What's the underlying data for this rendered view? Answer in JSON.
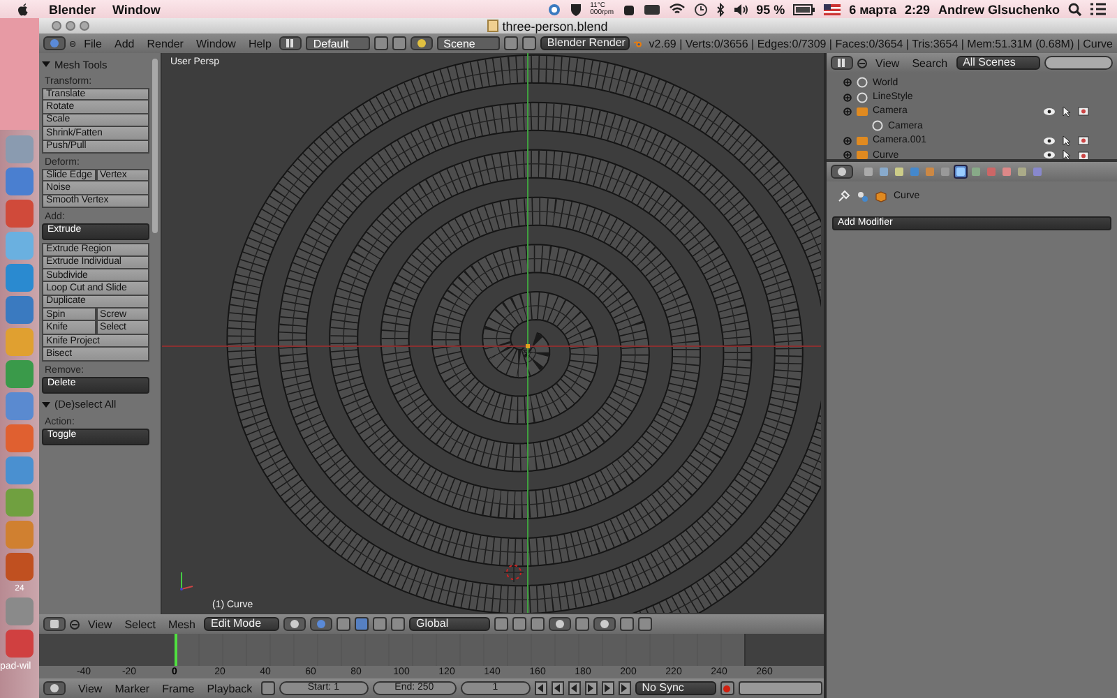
{
  "menubar": {
    "app": "Blender",
    "items": [
      "Window"
    ],
    "sensor": [
      "11°C",
      "000rpm"
    ],
    "battery": "95 %",
    "date": "6 марта",
    "time": "2:29",
    "user": "Andrew Glsuchenko"
  },
  "dock": {
    "badge": "24",
    "label": "pad-wil"
  },
  "window": {
    "title": "three-person.blend"
  },
  "info_header": {
    "menus": [
      "File",
      "Add",
      "Render",
      "Window",
      "Help"
    ],
    "layout": "Default",
    "scene": "Scene",
    "engine": "Blender Render",
    "stats": "v2.69 | Verts:0/3656 | Edges:0/7309 | Faces:0/3654 | Tris:3654 | Mem:51.31M (0.68M) | Curve"
  },
  "tool_panels": [
    {
      "title": "Mesh Tools",
      "expanded": true,
      "groups": [
        {
          "label": "Transform:",
          "rows": [
            [
              "Translate"
            ],
            [
              "Rotate"
            ],
            [
              "Scale"
            ],
            [
              "Shrink/Fatten"
            ],
            [
              "Push/Pull"
            ]
          ]
        },
        {
          "label": "Deform:",
          "rows": [
            [
              "Slide Edge",
              "Vertex"
            ],
            [
              "Noise"
            ],
            [
              "Smooth Vertex"
            ]
          ]
        },
        {
          "label": "Add:",
          "dropdown": "Extrude",
          "rows": [
            [
              "Extrude Region"
            ],
            [
              "Extrude Individual"
            ],
            [
              "Subdivide"
            ],
            [
              "Loop Cut and Slide"
            ],
            [
              "Duplicate"
            ],
            [
              "Spin",
              "Screw"
            ],
            [
              "Knife",
              "Select"
            ],
            [
              "Knife Project"
            ],
            [
              "Bisect"
            ]
          ]
        },
        {
          "label": "Remove:",
          "dropdown": "Delete"
        }
      ]
    },
    {
      "title": "(De)select All",
      "expanded": true,
      "groups": [
        {
          "label": "Action:",
          "dropdown": "Toggle"
        }
      ]
    }
  ],
  "viewport": {
    "view": "User Persp",
    "object": "(1) Curve"
  },
  "outliner": {
    "menus": [
      "View",
      "Search"
    ],
    "filter": "All Scenes",
    "items": [
      {
        "name": "World",
        "kind": "data"
      },
      {
        "name": "LineStyle",
        "kind": "data"
      },
      {
        "name": "Camera",
        "kind": "object",
        "children": [
          {
            "name": "Camera",
            "kind": "data"
          }
        ]
      },
      {
        "name": "Camera.001",
        "kind": "object"
      },
      {
        "name": "Curve",
        "kind": "object"
      }
    ]
  },
  "properties": {
    "tabs": [
      {
        "selected": false
      },
      {
        "selected": false
      },
      {
        "selected": false
      },
      {
        "selected": false
      },
      {
        "selected": false
      },
      {
        "selected": false
      },
      {
        "selected": true
      },
      {
        "selected": false
      },
      {
        "selected": false
      },
      {
        "selected": false
      },
      {
        "selected": false
      },
      {
        "selected": false
      }
    ],
    "breadcrumb": "Curve",
    "add_modifier": "Add Modifier"
  },
  "view3d_header": {
    "menus": [
      "View",
      "Select",
      "Mesh"
    ],
    "mode": "Edit Mode",
    "orientation": "Global"
  },
  "timeline": {
    "ticks": [
      {
        "label": "-40",
        "current": false
      },
      {
        "label": "-20",
        "current": false
      },
      {
        "label": "0",
        "current": true
      },
      {
        "label": "20",
        "current": false
      },
      {
        "label": "40",
        "current": false
      },
      {
        "label": "60",
        "current": false
      },
      {
        "label": "80",
        "current": false
      },
      {
        "label": "100",
        "current": false
      },
      {
        "label": "120",
        "current": false
      },
      {
        "label": "140",
        "current": false
      },
      {
        "label": "160",
        "current": false
      },
      {
        "label": "180",
        "current": false
      },
      {
        "label": "200",
        "current": false
      },
      {
        "label": "220",
        "current": false
      },
      {
        "label": "240",
        "current": false
      },
      {
        "label": "260",
        "current": false
      }
    ]
  },
  "timeline_header": {
    "menus": [
      "View",
      "Marker",
      "Frame",
      "Playback"
    ],
    "start": "Start: 1",
    "end": "End: 250",
    "frame": "1",
    "sync": "No Sync"
  }
}
